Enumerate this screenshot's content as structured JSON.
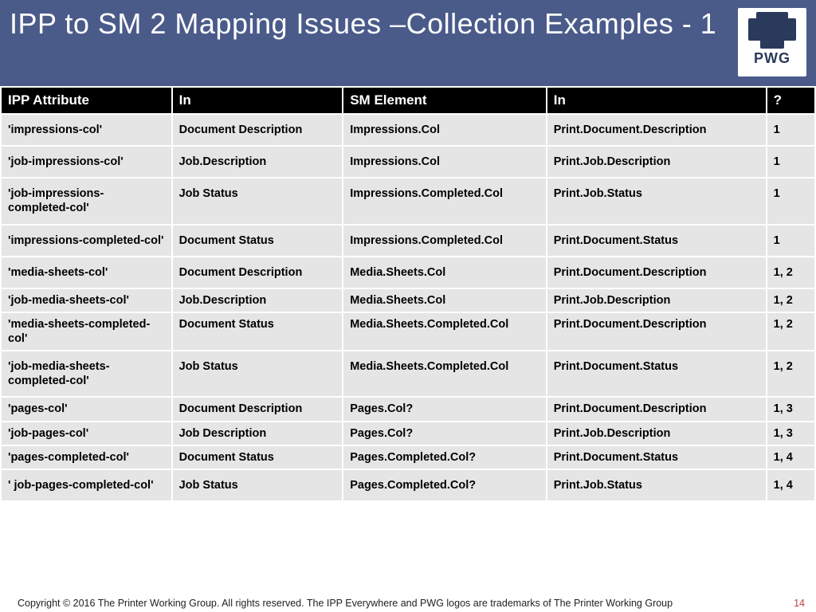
{
  "title": "IPP to SM 2 Mapping Issues –Collection Examples - 1",
  "logo_label": "PWG",
  "headers": [
    "IPP Attribute",
    "In",
    "SM Element",
    "In",
    "?"
  ],
  "rows": [
    {
      "c": [
        "'impressions-col'",
        "Document Description",
        "Impressions.Col",
        "Print.Document.Description",
        "1"
      ],
      "tight": false
    },
    {
      "c": [
        "'job-impressions-col'",
        "Job.Description",
        "Impressions.Col",
        "Print.Job.Description",
        "1"
      ],
      "tight": false
    },
    {
      "c": [
        "'job-impressions-completed-col'",
        "Job Status",
        "Impressions.Completed.Col",
        "Print.Job.Status",
        "1"
      ],
      "tight": false
    },
    {
      "c": [
        "'impressions-completed-col'",
        "Document Status",
        "Impressions.Completed.Col",
        "Print.Document.Status",
        "1"
      ],
      "tight": false
    },
    {
      "c": [
        "'media-sheets-col'",
        "Document Description",
        "Media.Sheets.Col",
        "Print.Document.Description",
        "1, 2"
      ],
      "tight": false
    },
    {
      "c": [
        "'job-media-sheets-col'",
        "Job.Description",
        "Media.Sheets.Col",
        "Print.Job.Description",
        "1, 2"
      ],
      "tight": true
    },
    {
      "c": [
        "'media-sheets-completed-col'",
        "Document Status",
        "Media.Sheets.Completed.Col",
        "Print.Document.Description",
        "1, 2"
      ],
      "tight": true
    },
    {
      "c": [
        "'job-media-sheets-completed-col'",
        "Job Status",
        "Media.Sheets.Completed.Col",
        "Print.Document.Status",
        "1, 2"
      ],
      "tight": false
    },
    {
      "c": [
        "'pages-col'",
        "Document Description",
        "Pages.Col?",
        "Print.Document.Description",
        "1, 3"
      ],
      "tight": true
    },
    {
      "c": [
        "'job-pages-col'",
        "Job Description",
        "Pages.Col?",
        "Print.Job.Description",
        "1, 3"
      ],
      "tight": true
    },
    {
      "c": [
        "'pages-completed-col'",
        "Document Status",
        "Pages.Completed.Col?",
        "Print.Document.Status",
        "1, 4"
      ],
      "tight": true
    },
    {
      "c": [
        "' job-pages-completed-col'",
        "Job Status",
        "Pages.Completed.Col?",
        "Print.Job.Status",
        "1, 4"
      ],
      "tight": false
    }
  ],
  "footer_text": "Copyright © 2016 The Printer Working Group. All rights reserved. The IPP Everywhere and PWG logos are trademarks of The Printer Working Group",
  "page_number": "14"
}
